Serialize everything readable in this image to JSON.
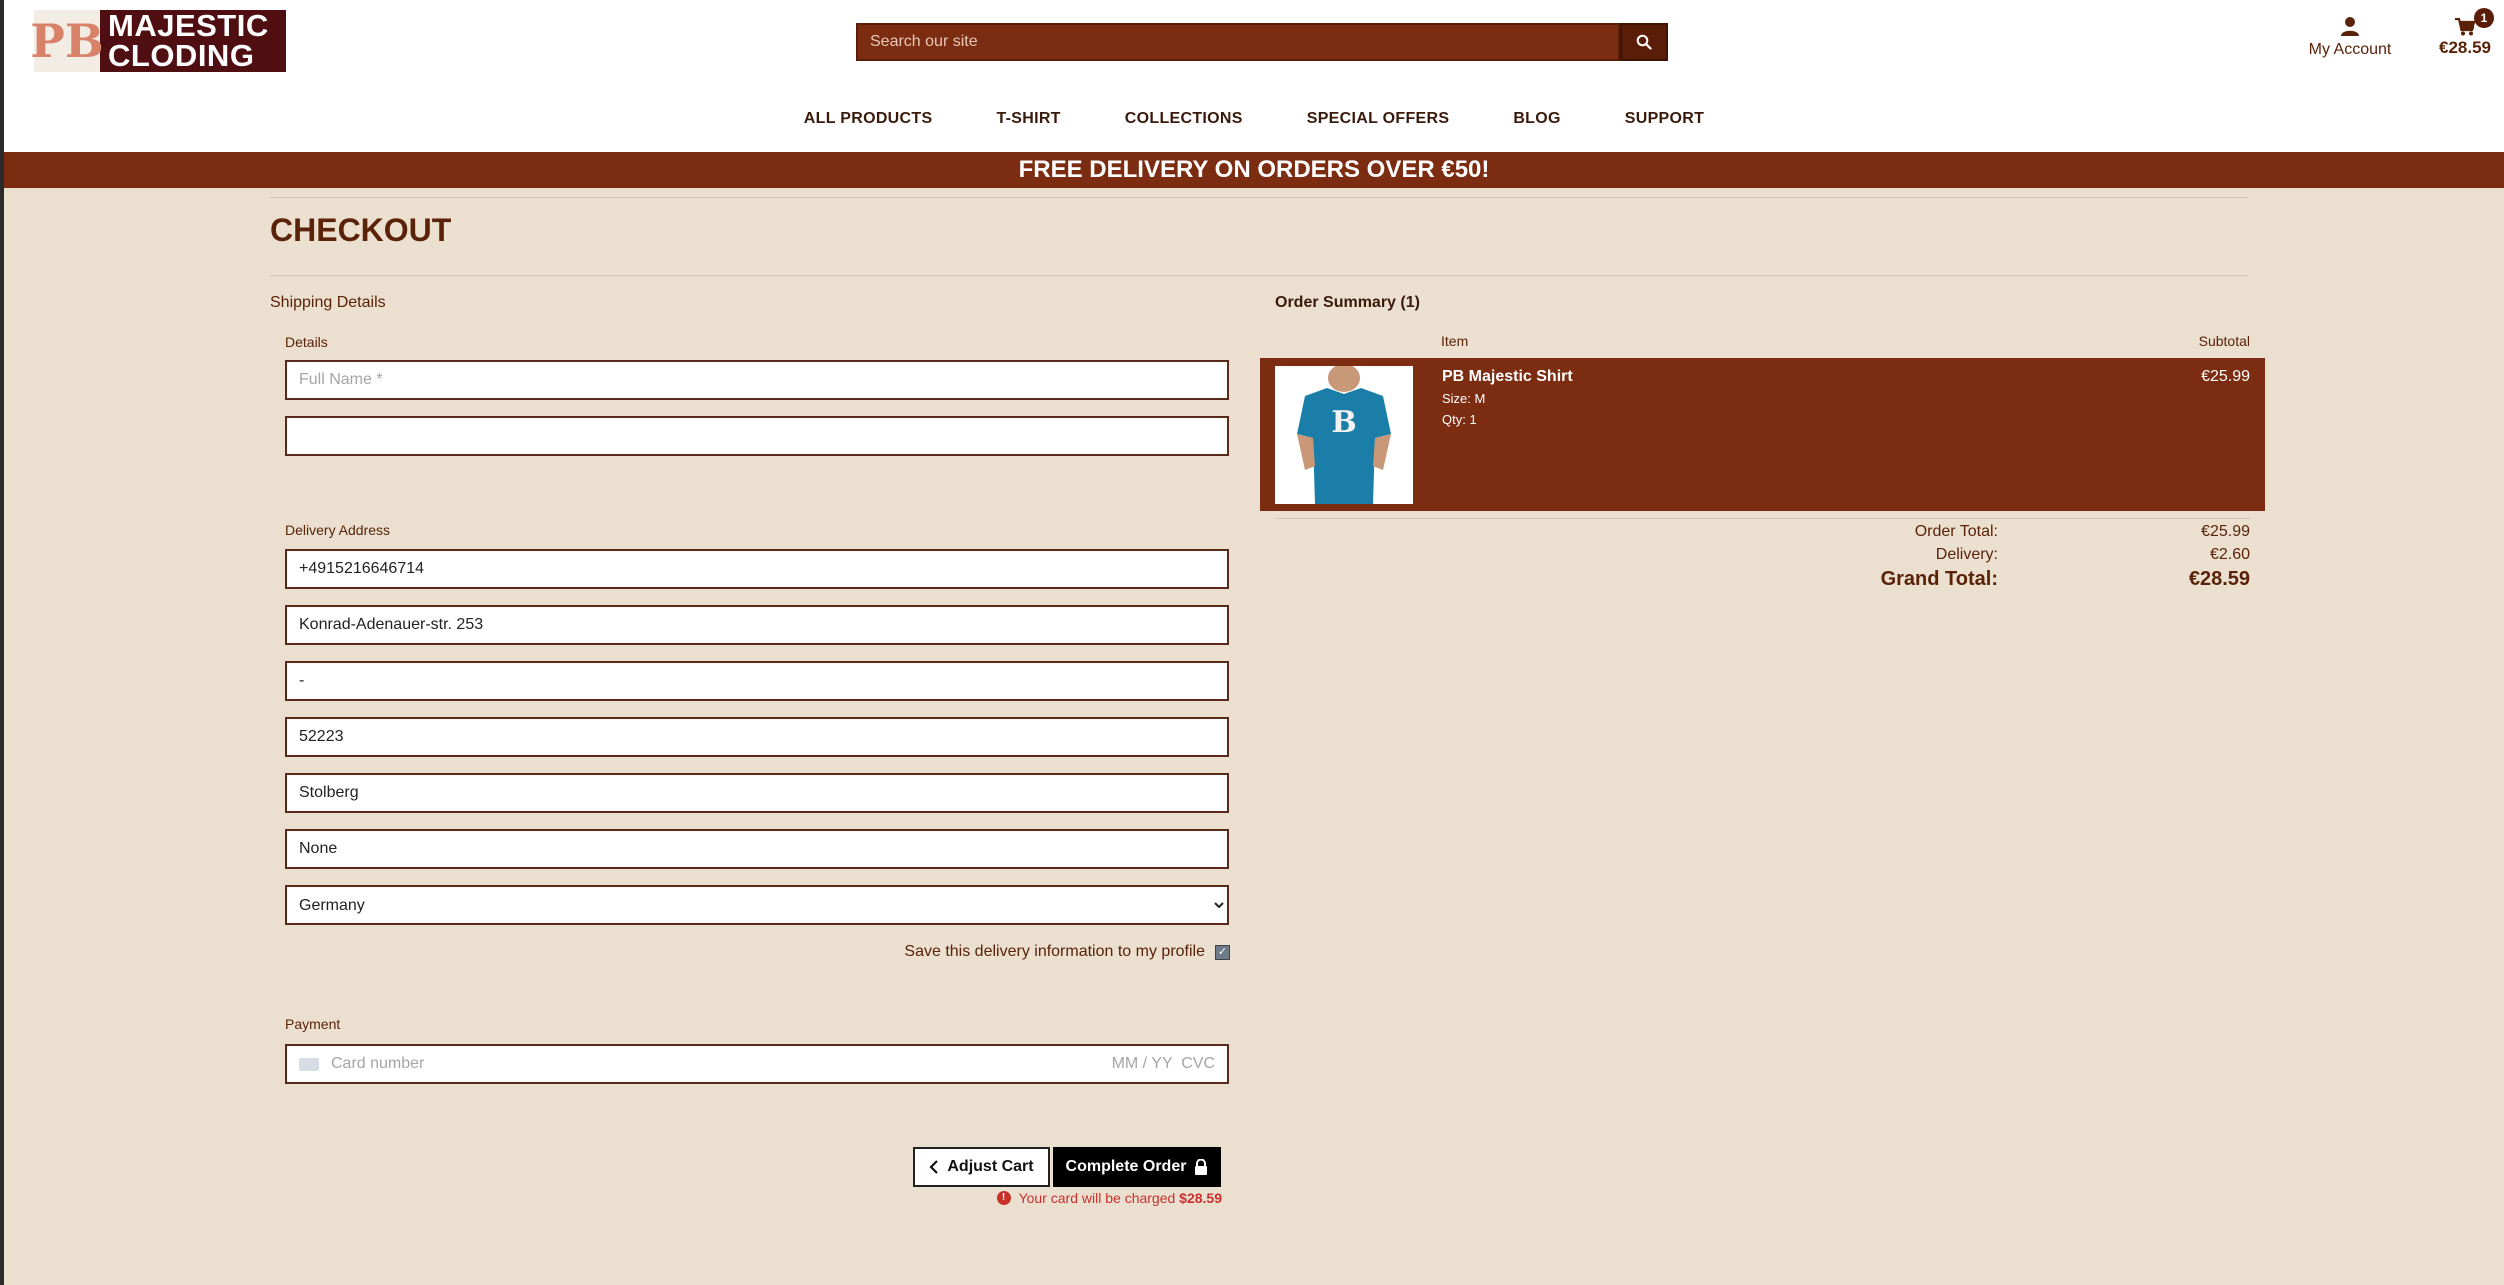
{
  "header": {
    "logo_mark": "PB",
    "logo_text": "MAJESTIC\nCLODING",
    "search_placeholder": "Search our site",
    "account_label": "My Account",
    "cart_total": "€28.59",
    "cart_count": "1"
  },
  "nav": {
    "items": [
      "ALL PRODUCTS",
      "T-SHIRT",
      "COLLECTIONS",
      "SPECIAL OFFERS",
      "BLOG",
      "SUPPORT"
    ]
  },
  "banner": "FREE DELIVERY ON ORDERS OVER €50!",
  "checkout": {
    "title": "CHECKOUT",
    "shipping_label": "Shipping Details",
    "details_label": "Details",
    "full_name_placeholder": "Full Name *",
    "full_name_value": "",
    "email_value": "",
    "delivery_label": "Delivery Address",
    "phone": "+4915216646714",
    "street1": "Konrad-Adenauer-str. 253",
    "street2": "-",
    "postcode": "52223",
    "town": "Stolberg",
    "county": "None",
    "country": "Germany",
    "save_info_label": "Save this delivery information to my profile",
    "payment_label": "Payment",
    "card_placeholder": "Card number",
    "card_exp_cvc": "MM / YY  CVC",
    "adjust_label": "Adjust Cart",
    "complete_label": "Complete Order",
    "charge_text": "Your card will be charged",
    "charge_amount": "$28.59"
  },
  "summary": {
    "title": "Order Summary (1)",
    "col_item": "Item",
    "col_subtotal": "Subtotal",
    "item": {
      "name": "PB Majestic Shirt",
      "size": "Size: M",
      "qty": "Qty: 1",
      "price": "€25.99"
    },
    "order_total_label": "Order Total:",
    "order_total": "€25.99",
    "delivery_label": "Delivery:",
    "delivery": "€2.60",
    "grand_total_label": "Grand Total:",
    "grand_total": "€28.59"
  },
  "colors": {
    "brand": "#7b2c11",
    "background": "#ebe0d0",
    "error": "#c9302c"
  }
}
